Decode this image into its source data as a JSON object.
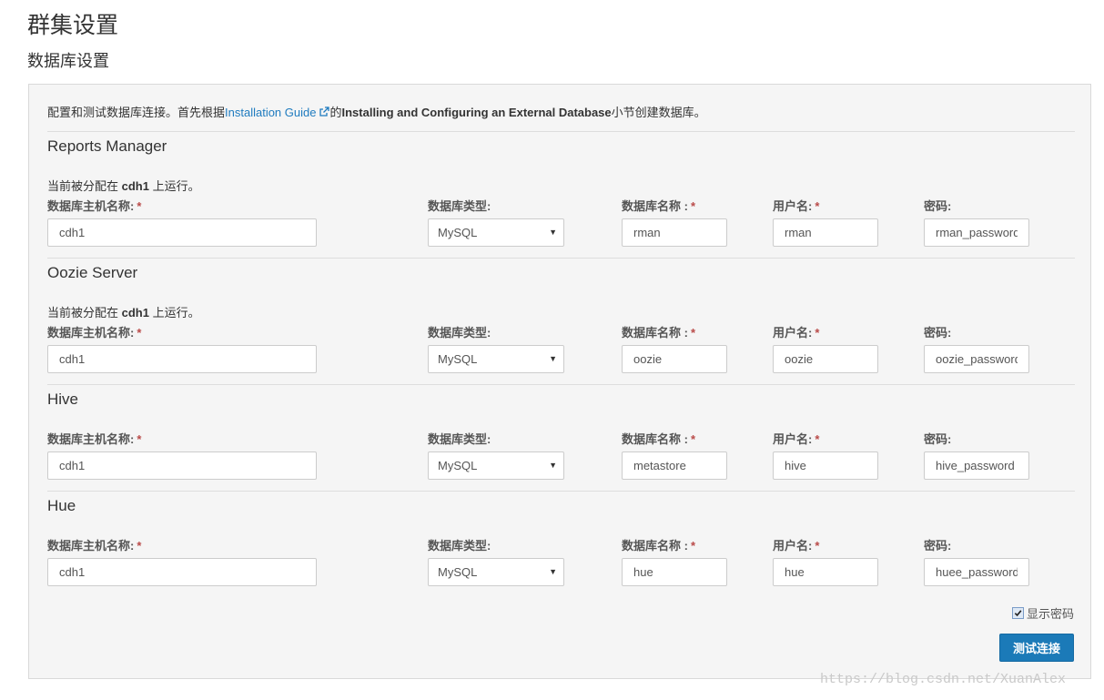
{
  "page": {
    "title": "群集设置",
    "section_title": "数据库设置"
  },
  "intro": {
    "prefix": "配置和测试数据库连接。首先根据",
    "link_text": "Installation Guide",
    "mid": "的",
    "bold_text": "Installing and Configuring an External Database",
    "suffix": "小节创建数据库。"
  },
  "labels": {
    "host": "数据库主机名称:",
    "type": "数据库类型:",
    "db_name": "数据库名称 :",
    "user": "用户名:",
    "password": "密码:",
    "required": "*"
  },
  "roles": [
    {
      "name": "Reports Manager",
      "assign_prefix": "当前被分配在 ",
      "assign_host": "cdh1",
      "assign_suffix": " 上运行。",
      "host": "cdh1",
      "type": "MySQL",
      "db_name": "rman",
      "user": "rman",
      "password": "rman_password"
    },
    {
      "name": "Oozie Server",
      "assign_prefix": "当前被分配在 ",
      "assign_host": "cdh1",
      "assign_suffix": " 上运行。",
      "host": "cdh1",
      "type": "MySQL",
      "db_name": "oozie",
      "user": "oozie",
      "password": "oozie_password"
    },
    {
      "name": "Hive",
      "host": "cdh1",
      "type": "MySQL",
      "db_name": "metastore",
      "user": "hive",
      "password": "hive_password"
    },
    {
      "name": "Hue",
      "host": "cdh1",
      "type": "MySQL",
      "db_name": "hue",
      "user": "hue",
      "password": "huee_password"
    }
  ],
  "show_password": {
    "label": "显示密码",
    "checked": true
  },
  "test_button": "测试连接",
  "watermark": "https://blog.csdn.net/XuanAlex",
  "icons": {
    "external_link": "external-link-icon",
    "select_caret": "caret-down-icon",
    "checkbox": "checkmark-icon"
  },
  "colors": {
    "link": "#1f7bbf",
    "button": "#1b7ab8",
    "required": "#b94a48",
    "panel_bg": "#f5f5f5"
  }
}
